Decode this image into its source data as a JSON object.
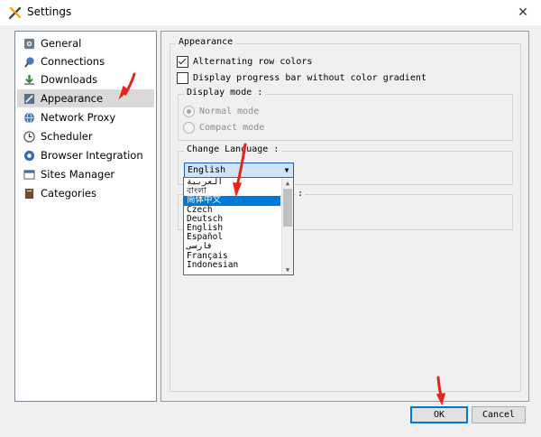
{
  "window": {
    "title": "Settings"
  },
  "sidebar": {
    "items": [
      {
        "label": "General",
        "icon": "gear-icon"
      },
      {
        "label": "Connections",
        "icon": "connections-icon"
      },
      {
        "label": "Downloads",
        "icon": "download-icon"
      },
      {
        "label": "Appearance",
        "icon": "appearance-icon",
        "selected": true
      },
      {
        "label": "Network Proxy",
        "icon": "globe-icon"
      },
      {
        "label": "Scheduler",
        "icon": "clock-icon"
      },
      {
        "label": "Browser Integration",
        "icon": "browser-icon"
      },
      {
        "label": "Sites Manager",
        "icon": "sites-icon"
      },
      {
        "label": "Categories",
        "icon": "categories-icon"
      }
    ]
  },
  "appearance": {
    "group_title": "Appearance",
    "alternating_row_colors": {
      "label": "Alternating row colors",
      "checked": true
    },
    "progress_bar_no_gradient": {
      "label": "Display progress bar without color gradient",
      "checked": false
    },
    "display_mode": {
      "title": "Display mode :",
      "normal": "Normal mode",
      "compact": "Compact mode"
    },
    "change_language": {
      "title": "Change Language :",
      "selected": "English",
      "options": [
        "العربية",
        "বাংলা",
        "简体中文",
        "Czech",
        "Deutsch",
        "English",
        "Español",
        "فارسی",
        "Français",
        "Indonesian"
      ],
      "highlighted_index": 2
    },
    "hidden_group_partial": ":"
  },
  "buttons": {
    "ok": "OK",
    "cancel": "Cancel"
  },
  "colors": {
    "accent": "#0078d7",
    "annotation_arrow": "#e8231b"
  }
}
